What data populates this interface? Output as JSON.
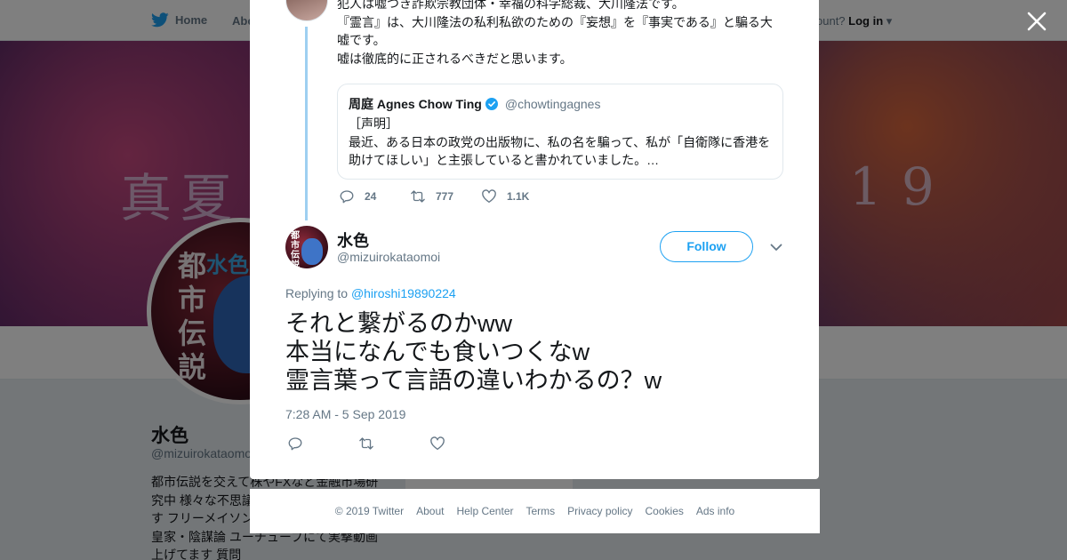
{
  "topnav": {
    "home_label": "Home",
    "about_label": "Abo",
    "account_prompt": "ccount?",
    "login_label": "Log in"
  },
  "banner": {
    "left_text": "真夏",
    "right_text": "19"
  },
  "profile": {
    "avatar_kanji": "都市伝説",
    "avatar_blue_text": "水色",
    "name": "水色",
    "handle": "@mizuirokataomoi",
    "bio_lines": [
      "都市伝説を交えて株やFXなど金融市場研",
      "究中 様々な不思議",
      "す フリーメイソン",
      "皇家・陰謀論 ユーチューブにて実撃動画",
      "上げてます 質問"
    ]
  },
  "modal": {
    "parent_tweet": {
      "lines": [
        "犯人は嘘つき詐欺宗教団体・幸福の科学総裁、大川隆法です。",
        "『霊言』は、大川隆法の私利私欲のための『妄想』を『事実である』と騙る大",
        "嘘です。",
        "嘘は徹底的に正されるべきだと思います。"
      ],
      "quote": {
        "name": "周庭 Agnes Chow Ting",
        "handle": "@chowtingagnes",
        "body_lines": [
          "［声明］",
          "最近、ある日本の政党の出版物に、私の名を騙って、私が「自衛隊に香港を",
          "助けてほしい」と主張していると書かれていました。…"
        ]
      },
      "actions": {
        "replies": "24",
        "retweets": "777",
        "likes": "1.1K"
      }
    },
    "tweet": {
      "avatar_text": "都市伝説",
      "name": "水色",
      "handle": "@mizuirokataomoi",
      "follow_label": "Follow",
      "replying_prefix": "Replying to",
      "replying_to": "@hiroshi19890224",
      "text_lines": [
        "それと繋がるのかww",
        "本当になんでも食いつくなw",
        "霊言葉って言語の違いわかるの？w"
      ],
      "timestamp": "7:28 AM - 5 Sep 2019"
    }
  },
  "footer": {
    "links": [
      "© 2019 Twitter",
      "About",
      "Help Center",
      "Terms",
      "Privacy policy",
      "Cookies",
      "Ads info"
    ]
  },
  "colors": {
    "accent": "#1da1f2",
    "thread_line": "#9ecff1",
    "text_primary": "#14171a",
    "text_secondary": "#657786"
  },
  "icons": [
    "twitter-bird-icon",
    "close-icon",
    "verified-badge-icon",
    "reply-icon",
    "retweet-icon",
    "like-icon",
    "chevron-down-icon"
  ]
}
